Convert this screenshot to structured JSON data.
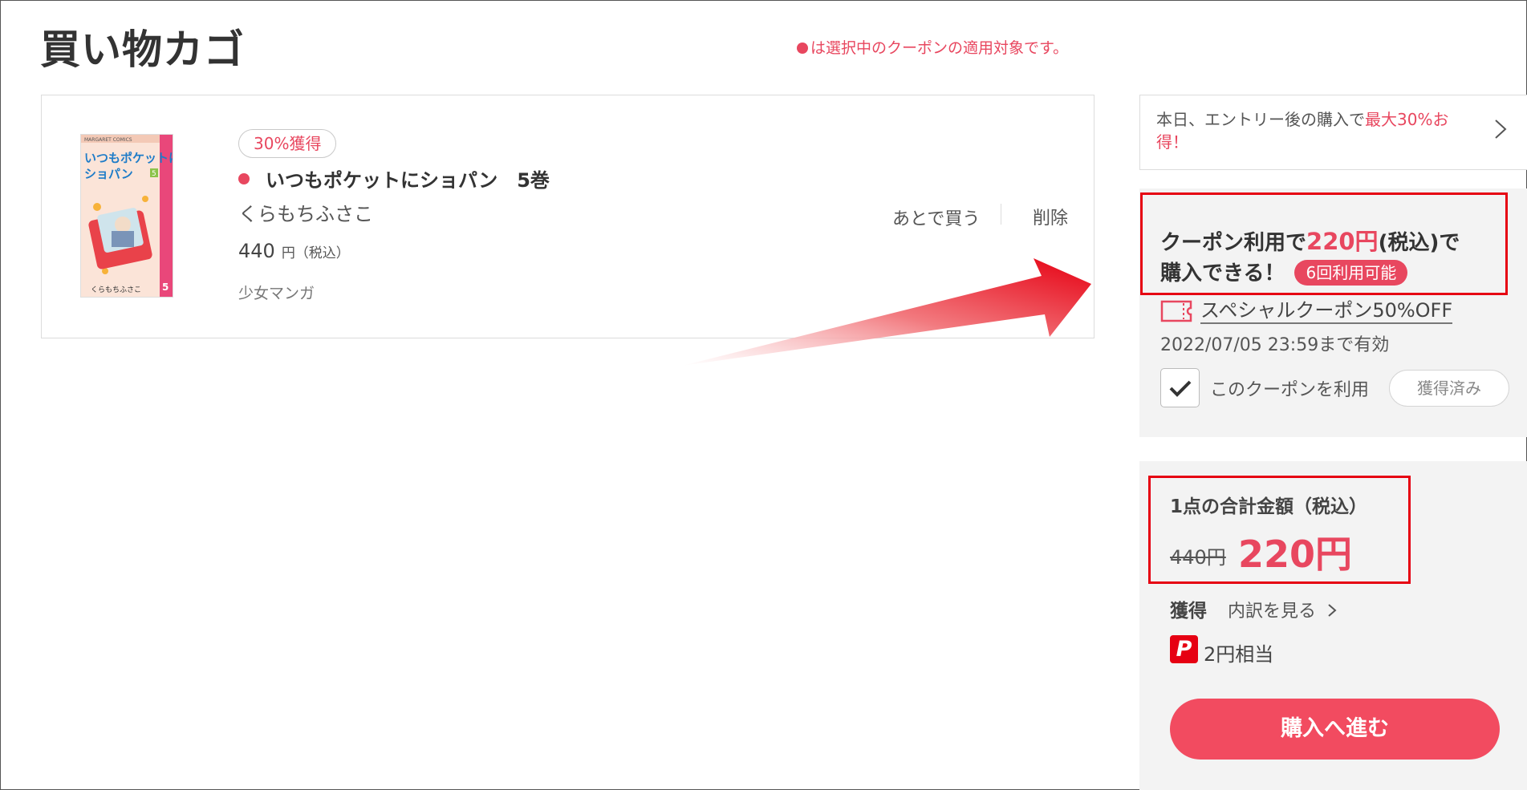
{
  "page": {
    "title": "買い物カゴ",
    "coupon_note": "は選択中のクーポンの適用対象です。"
  },
  "cart": {
    "items": [
      {
        "reward_badge": "30%獲得",
        "title": "いつもポケットにショパン　5巻",
        "author": "くらもちふさこ",
        "price": "440",
        "price_unit": "円（税込）",
        "genre": "少女マンガ",
        "later_label": "あとで買う",
        "delete_label": "削除",
        "cover": {
          "series_label": "MARGARET COMICS",
          "title_line1": "いつもポケットに",
          "title_line2": "ショパン",
          "volume": "5",
          "author": "くらもちふさこ"
        }
      }
    ]
  },
  "entry_banner": {
    "text_before": "本日、エントリー後の購入で",
    "text_highlight": "最大30%お得！"
  },
  "coupon": {
    "head_before": "クーポン利用で",
    "head_price": "220円",
    "head_after": "(税込)で",
    "head_line2": "購入できる！",
    "uses_badge": "6回利用可能",
    "name": "スペシャルクーポン50%OFF",
    "expiry": "2022/07/05 23:59まで有効",
    "use_label": "このクーポンを利用",
    "acquired_label": "獲得済み"
  },
  "summary": {
    "total_label": "1点の合計金額（税込）",
    "original_price": "440円",
    "final_price": "220円",
    "earn_label": "獲得",
    "breakdown_link": "内訳を見る",
    "points_value": "2円相当",
    "checkout_label": "購入へ進む"
  },
  "colors": {
    "accent": "#e8475f",
    "highlight_border": "#e60012",
    "panel_bg": "#f3f3f3"
  },
  "icons": [
    "ticket-icon",
    "checkmark-icon",
    "chevron-right-icon",
    "paypay-icon"
  ]
}
